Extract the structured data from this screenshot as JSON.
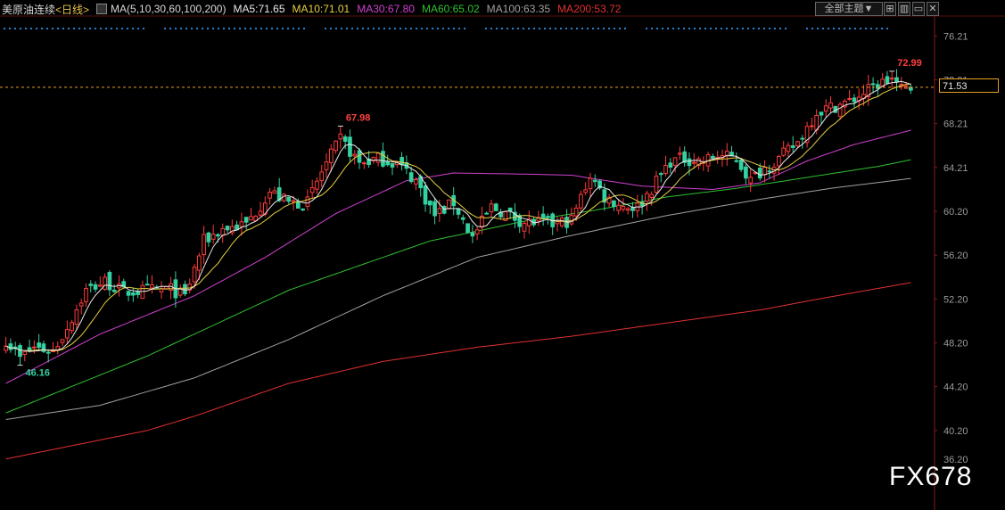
{
  "header": {
    "instrument": "美原油连续",
    "period": "<日线>",
    "ma_params": "MA(5,10,30,60,100,200)",
    "ma_values": [
      {
        "label": "MA5:71.65",
        "color": "#e8e8e8"
      },
      {
        "label": "MA10:71.01",
        "color": "#e8d040"
      },
      {
        "label": "MA30:67.80",
        "color": "#d040d0"
      },
      {
        "label": "MA60:65.02",
        "color": "#30c030"
      },
      {
        "label": "MA100:63.35",
        "color": "#a0a0a0"
      },
      {
        "label": "MA200:53.72",
        "color": "#e03030"
      }
    ],
    "theme_button": "全部主题▼"
  },
  "chart_data": {
    "type": "candlestick",
    "title": "美原油连续",
    "y_ticks": [
      "76.21",
      "72.21",
      "68.21",
      "64.21",
      "60.20",
      "56.20",
      "52.20",
      "48.20",
      "44.20",
      "40.20"
    ],
    "ylim": [
      37.5,
      77.7
    ],
    "current_price": "71.53",
    "hidden_tick": "36.20",
    "annotations": [
      {
        "text": "72.99",
        "value": 72.99,
        "bar": 188
      },
      {
        "text": "67.98",
        "value": 67.98,
        "bar": 71
      },
      {
        "text": "46.16",
        "value": 46.16,
        "bar": 3
      }
    ],
    "bars": 193,
    "anchors_close": [
      [
        0,
        48.5
      ],
      [
        3,
        46.8
      ],
      [
        6,
        47.8
      ],
      [
        10,
        47.4
      ],
      [
        13,
        49.6
      ],
      [
        17,
        53.0
      ],
      [
        21,
        53.8
      ],
      [
        25,
        52.8
      ],
      [
        30,
        53.0
      ],
      [
        35,
        53.1
      ],
      [
        38,
        52.4
      ],
      [
        42,
        57.5
      ],
      [
        46,
        58.6
      ],
      [
        51,
        59.0
      ],
      [
        56,
        62.0
      ],
      [
        60,
        61.0
      ],
      [
        64,
        61.0
      ],
      [
        67,
        63.8
      ],
      [
        71,
        66.8
      ],
      [
        75,
        64.6
      ],
      [
        79,
        65.0
      ],
      [
        83,
        64.6
      ],
      [
        87,
        63.0
      ],
      [
        91,
        59.8
      ],
      [
        95,
        61.0
      ],
      [
        99,
        57.8
      ],
      [
        103,
        60.6
      ],
      [
        106,
        60.0
      ],
      [
        110,
        59.2
      ],
      [
        113,
        59.2
      ],
      [
        116,
        59.0
      ],
      [
        120,
        59.4
      ],
      [
        124,
        63.5
      ],
      [
        127,
        61.5
      ],
      [
        131,
        60.7
      ],
      [
        134,
        60.6
      ],
      [
        137,
        62.3
      ],
      [
        141,
        64.8
      ],
      [
        144,
        65.0
      ],
      [
        148,
        64.8
      ],
      [
        151,
        65.3
      ],
      [
        155,
        65.0
      ],
      [
        158,
        63.0
      ],
      [
        161,
        64.2
      ],
      [
        164,
        65.0
      ],
      [
        168,
        66.5
      ],
      [
        172,
        69.3
      ],
      [
        175,
        69.7
      ],
      [
        179,
        70.2
      ],
      [
        182,
        71.0
      ],
      [
        185,
        71.8
      ],
      [
        188,
        72.3
      ],
      [
        190,
        71.3
      ],
      [
        192,
        71.5
      ]
    ],
    "ma30_anchors": [
      [
        0,
        44.5
      ],
      [
        20,
        49.0
      ],
      [
        40,
        52.5
      ],
      [
        55,
        56.0
      ],
      [
        70,
        60.0
      ],
      [
        85,
        63.0
      ],
      [
        95,
        63.7
      ],
      [
        110,
        63.6
      ],
      [
        120,
        63.5
      ],
      [
        135,
        62.5
      ],
      [
        150,
        62.2
      ],
      [
        160,
        62.8
      ],
      [
        170,
        64.8
      ],
      [
        180,
        66.3
      ],
      [
        192,
        67.6
      ]
    ],
    "ma60_anchors": [
      [
        0,
        41.8
      ],
      [
        30,
        47.0
      ],
      [
        60,
        53.0
      ],
      [
        90,
        57.5
      ],
      [
        110,
        59.3
      ],
      [
        125,
        60.3
      ],
      [
        140,
        61.5
      ],
      [
        155,
        62.3
      ],
      [
        170,
        63.3
      ],
      [
        185,
        64.3
      ],
      [
        192,
        64.9
      ]
    ],
    "ma100_anchors": [
      [
        0,
        41.2
      ],
      [
        20,
        42.5
      ],
      [
        40,
        45.0
      ],
      [
        60,
        48.5
      ],
      [
        80,
        52.5
      ],
      [
        100,
        56.0
      ],
      [
        120,
        58.0
      ],
      [
        140,
        59.8
      ],
      [
        160,
        61.3
      ],
      [
        175,
        62.3
      ],
      [
        192,
        63.2
      ]
    ],
    "ma200_anchors": [
      [
        0,
        37.6
      ],
      [
        30,
        40.2
      ],
      [
        40,
        41.5
      ],
      [
        60,
        44.5
      ],
      [
        80,
        46.5
      ],
      [
        100,
        47.8
      ],
      [
        120,
        48.8
      ],
      [
        140,
        50.0
      ],
      [
        160,
        51.2
      ],
      [
        175,
        52.4
      ],
      [
        192,
        53.7
      ]
    ]
  },
  "watermark": "FX678"
}
